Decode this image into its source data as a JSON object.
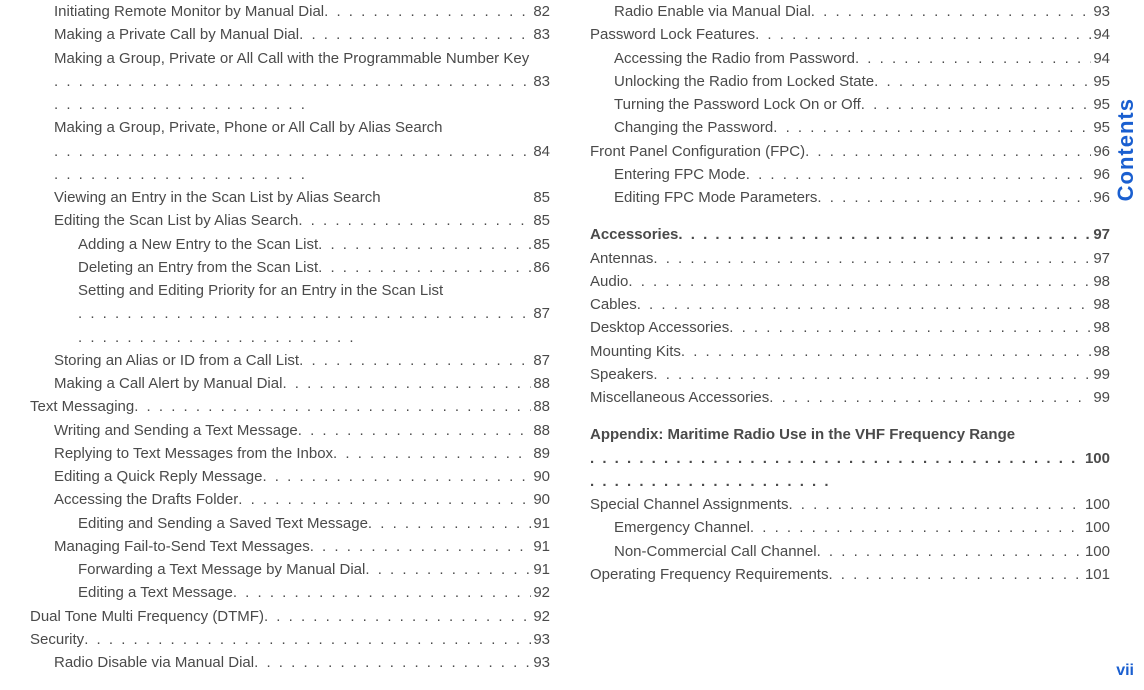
{
  "side_tab": "Contents",
  "page_number": "vii",
  "left_column": [
    {
      "level": 2,
      "label": "Initiating Remote Monitor by Manual Dial",
      "page": "82"
    },
    {
      "level": 2,
      "label": "Making a Private Call by Manual Dial",
      "page": "83"
    },
    {
      "level": 2,
      "label": "Making a Group, Private or All Call with the Programmable Number Key",
      "page": "83",
      "wrap": true
    },
    {
      "level": 2,
      "label": "Making a Group, Private, Phone or All Call by Alias Search",
      "page": "84",
      "wrap": true
    },
    {
      "level": 2,
      "label": "Viewing an Entry in the Scan List by Alias Search",
      "page": "85",
      "nodots": true
    },
    {
      "level": 2,
      "label": "Editing the Scan List by Alias Search",
      "page": "85"
    },
    {
      "level": 3,
      "label": "Adding a New Entry to the Scan List",
      "page": "85"
    },
    {
      "level": 3,
      "label": "Deleting an Entry from the Scan List",
      "page": "86"
    },
    {
      "level": 3,
      "label": "Setting and Editing Priority for an Entry in the Scan List",
      "page": "87",
      "wrap": true
    },
    {
      "level": 2,
      "label": "Storing an Alias or ID from a Call List",
      "page": "87"
    },
    {
      "level": 2,
      "label": "Making a Call Alert by Manual Dial",
      "page": "88"
    },
    {
      "level": 1,
      "label": "Text Messaging",
      "page": "88"
    },
    {
      "level": 2,
      "label": "Writing and Sending a Text Message",
      "page": "88"
    },
    {
      "level": 2,
      "label": "Replying to Text Messages from the Inbox",
      "page": "89"
    },
    {
      "level": 2,
      "label": "Editing a Quick Reply Message",
      "page": "90"
    },
    {
      "level": 2,
      "label": "Accessing the Drafts Folder",
      "page": "90"
    },
    {
      "level": 3,
      "label": "Editing and Sending a Saved Text Message",
      "page": "91"
    },
    {
      "level": 2,
      "label": "Managing Fail-to-Send Text Messages",
      "page": "91"
    },
    {
      "level": 3,
      "label": "Forwarding a Text Message by Manual Dial",
      "page": "91"
    },
    {
      "level": 3,
      "label": "Editing a Text Message",
      "page": "92"
    },
    {
      "level": 1,
      "label": "Dual Tone Multi Frequency (DTMF)",
      "page": "92"
    },
    {
      "level": 1,
      "label": "Security",
      "page": "93"
    },
    {
      "level": 2,
      "label": "Radio Disable via Manual Dial",
      "page": "93"
    }
  ],
  "right_column": [
    {
      "level": 2,
      "label": "Radio Enable via Manual Dial",
      "page": "93"
    },
    {
      "level": 1,
      "label": "Password Lock Features",
      "page": "94"
    },
    {
      "level": 2,
      "label": "Accessing the Radio from Password",
      "page": "94"
    },
    {
      "level": 2,
      "label": "Unlocking the Radio from Locked State",
      "page": "95"
    },
    {
      "level": 2,
      "label": "Turning the Password Lock On or Off",
      "page": "95"
    },
    {
      "level": 2,
      "label": "Changing the Password",
      "page": "95"
    },
    {
      "level": 1,
      "label": "Front Panel Configuration (FPC)",
      "page": "96"
    },
    {
      "level": 2,
      "label": "Entering FPC Mode",
      "page": "96"
    },
    {
      "level": 2,
      "label": "Editing FPC Mode Parameters",
      "page": "96"
    },
    {
      "level": 0,
      "label": "Accessories",
      "page": "97",
      "spaced": true
    },
    {
      "level": 1,
      "label": "Antennas",
      "page": "97"
    },
    {
      "level": 1,
      "label": "Audio",
      "page": "98"
    },
    {
      "level": 1,
      "label": "Cables",
      "page": "98"
    },
    {
      "level": 1,
      "label": "Desktop Accessories",
      "page": "98"
    },
    {
      "level": 1,
      "label": "Mounting Kits",
      "page": "98"
    },
    {
      "level": 1,
      "label": "Speakers",
      "page": "99"
    },
    {
      "level": 1,
      "label": "Miscellaneous Accessories",
      "page": "99"
    },
    {
      "level": 0,
      "label": "Appendix: Maritime Radio Use in the VHF Frequency Range",
      "page": "100",
      "wrap": true,
      "spaced": true
    },
    {
      "level": 1,
      "label": "Special Channel Assignments",
      "page": "100"
    },
    {
      "level": 2,
      "label": "Emergency Channel",
      "page": "100"
    },
    {
      "level": 2,
      "label": "Non-Commercial Call Channel",
      "page": "100"
    },
    {
      "level": 1,
      "label": "Operating Frequency Requirements",
      "page": "101"
    }
  ]
}
